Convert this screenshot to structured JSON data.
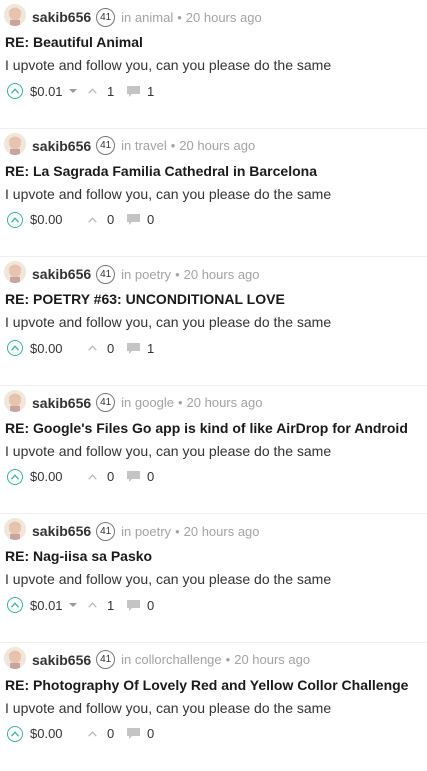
{
  "colors": {
    "accent": "#2fb59a",
    "muted": "#a3a3a3",
    "text": "#333333"
  },
  "icons": {
    "avatar": "avatar-image",
    "vote": "upvote-circle-icon",
    "votes": "chevron-up-icon",
    "comments": "comment-bubble-icon",
    "dropdown": "caret-down-icon"
  },
  "posts": [
    {
      "author": "sakib656",
      "reputation": "41",
      "category_prefix": "in",
      "category": "animal",
      "separator": "•",
      "time": "20 hours ago",
      "title": "RE: Beautiful Animal",
      "body": "I upvote and follow you, can you please do the same",
      "payout": "$0.01",
      "has_dropdown": true,
      "votes": "1",
      "comments": "1"
    },
    {
      "author": "sakib656",
      "reputation": "41",
      "category_prefix": "in",
      "category": "travel",
      "separator": "•",
      "time": "20 hours ago",
      "title": "RE: La Sagrada Familia Cathedral in Barcelona",
      "body": "I upvote and follow you, can you please do the same",
      "payout": "$0.00",
      "has_dropdown": false,
      "votes": "0",
      "comments": "0"
    },
    {
      "author": "sakib656",
      "reputation": "41",
      "category_prefix": "in",
      "category": "poetry",
      "separator": "•",
      "time": "20 hours ago",
      "title": "RE: POETRY #63: UNCONDITIONAL LOVE",
      "body": "I upvote and follow you, can you please do the same",
      "payout": "$0.00",
      "has_dropdown": false,
      "votes": "0",
      "comments": "1"
    },
    {
      "author": "sakib656",
      "reputation": "41",
      "category_prefix": "in",
      "category": "google",
      "separator": "•",
      "time": "20 hours ago",
      "title": "RE: Google's Files Go app is kind of like AirDrop for Android",
      "body": "I upvote and follow you, can you please do the same",
      "payout": "$0.00",
      "has_dropdown": false,
      "votes": "0",
      "comments": "0"
    },
    {
      "author": "sakib656",
      "reputation": "41",
      "category_prefix": "in",
      "category": "poetry",
      "separator": "•",
      "time": "20 hours ago",
      "title": "RE: Nag-iisa sa Pasko",
      "body": "I upvote and follow you, can you please do the same",
      "payout": "$0.01",
      "has_dropdown": true,
      "votes": "1",
      "comments": "0"
    },
    {
      "author": "sakib656",
      "reputation": "41",
      "category_prefix": "in",
      "category": "collorchallenge",
      "separator": "•",
      "time": "20 hours ago",
      "title": "RE: Photography Of Lovely Red and Yellow Collor Challenge",
      "body": "I upvote and follow you, can you please do the same",
      "payout": "$0.00",
      "has_dropdown": false,
      "votes": "0",
      "comments": "0"
    }
  ]
}
